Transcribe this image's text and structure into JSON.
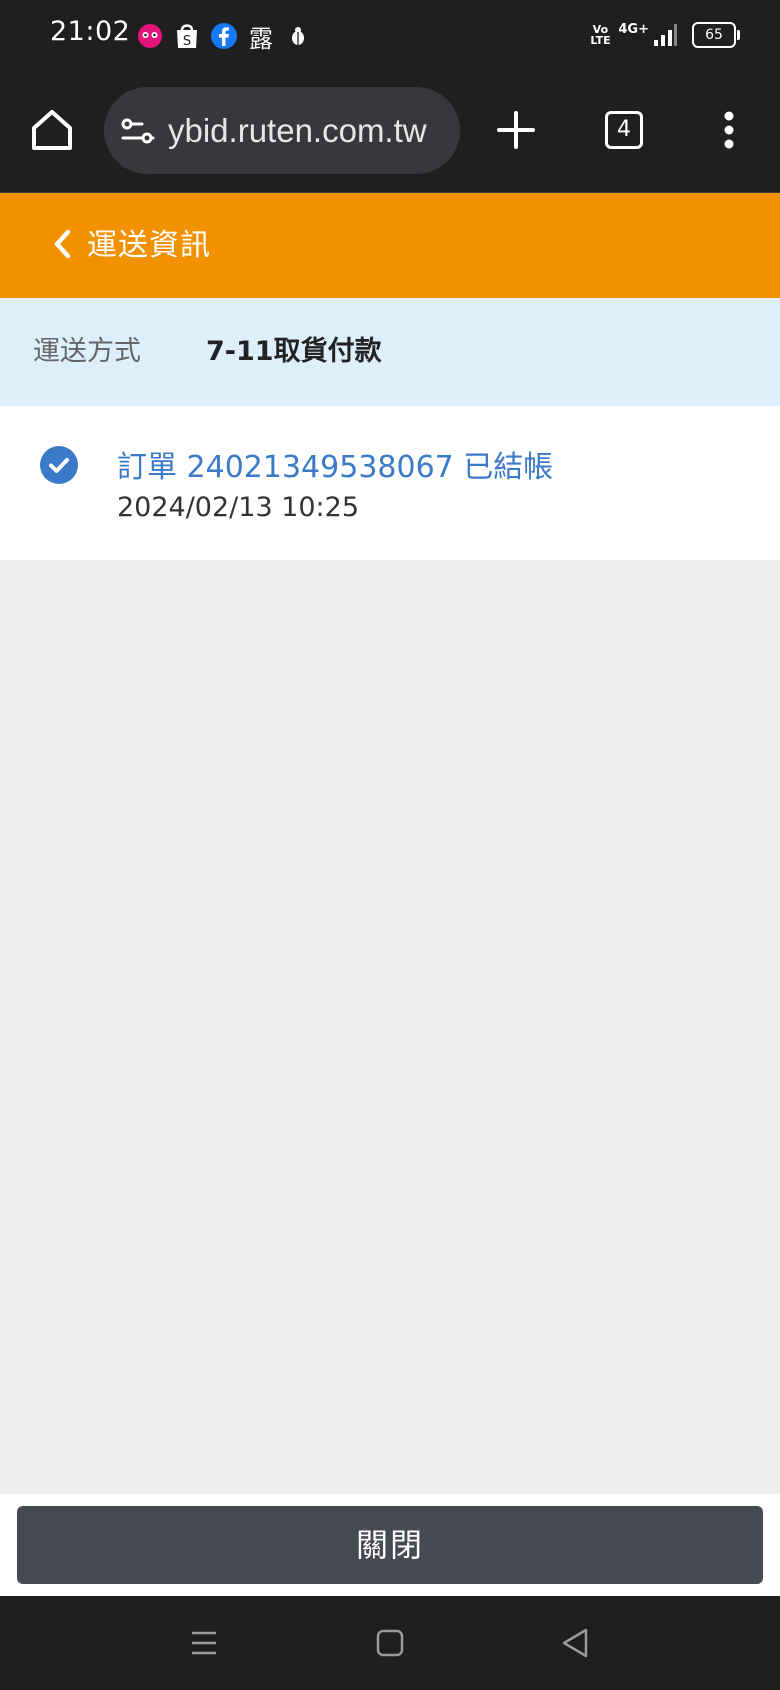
{
  "status_bar": {
    "time": "21:02",
    "notification_icons": [
      "foodpanda-icon",
      "shopping-bag-icon",
      "facebook-icon",
      "app-icon",
      "bug-icon"
    ],
    "notification_char": "露",
    "volte": "Vo LTE",
    "network": "4G+",
    "battery": "65"
  },
  "browser": {
    "url": "ybid.ruten.com.tw",
    "tab_count": "4"
  },
  "app_bar": {
    "title": "運送資訊"
  },
  "delivery": {
    "label": "運送方式",
    "value": "7-11取貨付款"
  },
  "timeline": [
    {
      "title": "訂單 24021349538067 已結帳",
      "time": "2024/02/13 10:25"
    }
  ],
  "footer": {
    "close_label": "關閉"
  },
  "colors": {
    "accent_orange": "#f19100",
    "info_blue": "#3b7ac8",
    "light_blue_bg": "#ddeffb",
    "button_dark": "#474a53"
  }
}
